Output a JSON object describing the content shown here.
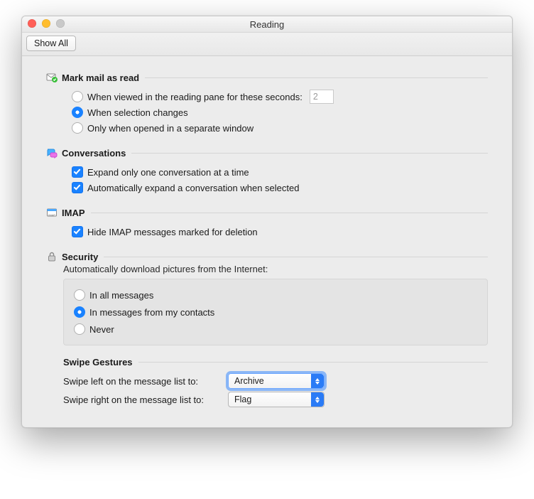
{
  "window": {
    "title": "Reading"
  },
  "toolbar": {
    "showAll": "Show All"
  },
  "markRead": {
    "title": "Mark mail as read",
    "opt1": "When viewed in the reading pane for these seconds:",
    "secondsValue": "2",
    "opt2": "When selection changes",
    "opt3": "Only when opened in a separate window"
  },
  "conversations": {
    "title": "Conversations",
    "opt1": "Expand only one conversation at a time",
    "opt2": "Automatically expand a conversation when selected"
  },
  "imap": {
    "title": "IMAP",
    "opt1": "Hide IMAP messages marked for deletion"
  },
  "security": {
    "title": "Security",
    "desc": "Automatically download pictures from the Internet:",
    "opt1": "In all messages",
    "opt2": "In messages from my contacts",
    "opt3": "Never"
  },
  "swipe": {
    "title": "Swipe Gestures",
    "leftLabel": "Swipe left on the message list to:",
    "leftValue": "Archive",
    "rightLabel": "Swipe right on the message list to:",
    "rightValue": "Flag"
  }
}
